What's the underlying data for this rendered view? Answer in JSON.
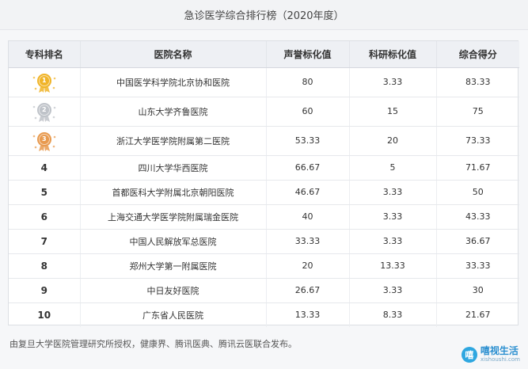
{
  "title": "急诊医学综合排行榜（2020年度）",
  "headers": [
    "专科排名",
    "医院名称",
    "声誉标化值",
    "科研标化值",
    "综合得分"
  ],
  "medal_colors": {
    "gold": "#f0b429",
    "silver": "#bfc3c9",
    "bronze": "#e89a4f"
  },
  "rows": [
    {
      "rank": "1",
      "medal": "gold",
      "hospital": "中国医学科学院北京协和医院",
      "reputation": "80",
      "research": "3.33",
      "score": "83.33"
    },
    {
      "rank": "2",
      "medal": "silver",
      "hospital": "山东大学齐鲁医院",
      "reputation": "60",
      "research": "15",
      "score": "75"
    },
    {
      "rank": "3",
      "medal": "bronze",
      "hospital": "浙江大学医学院附属第二医院",
      "reputation": "53.33",
      "research": "20",
      "score": "73.33"
    },
    {
      "rank": "4",
      "medal": null,
      "hospital": "四川大学华西医院",
      "reputation": "66.67",
      "research": "5",
      "score": "71.67"
    },
    {
      "rank": "5",
      "medal": null,
      "hospital": "首都医科大学附属北京朝阳医院",
      "reputation": "46.67",
      "research": "3.33",
      "score": "50"
    },
    {
      "rank": "6",
      "medal": null,
      "hospital": "上海交通大学医学院附属瑞金医院",
      "reputation": "40",
      "research": "3.33",
      "score": "43.33"
    },
    {
      "rank": "7",
      "medal": null,
      "hospital": "中国人民解放军总医院",
      "reputation": "33.33",
      "research": "3.33",
      "score": "36.67"
    },
    {
      "rank": "8",
      "medal": null,
      "hospital": "郑州大学第一附属医院",
      "reputation": "20",
      "research": "13.33",
      "score": "33.33"
    },
    {
      "rank": "9",
      "medal": null,
      "hospital": "中日友好医院",
      "reputation": "26.67",
      "research": "3.33",
      "score": "30"
    },
    {
      "rank": "10",
      "medal": null,
      "hospital": "广东省人民医院",
      "reputation": "13.33",
      "research": "8.33",
      "score": "21.67"
    }
  ],
  "footer": "由复旦大学医院管理研究所授权，健康界、腾讯医典、腾讯云医联合发布。",
  "watermark": {
    "logo_letter": "嘻",
    "main": "嘻视生活",
    "sub": "xishoushi.com"
  }
}
